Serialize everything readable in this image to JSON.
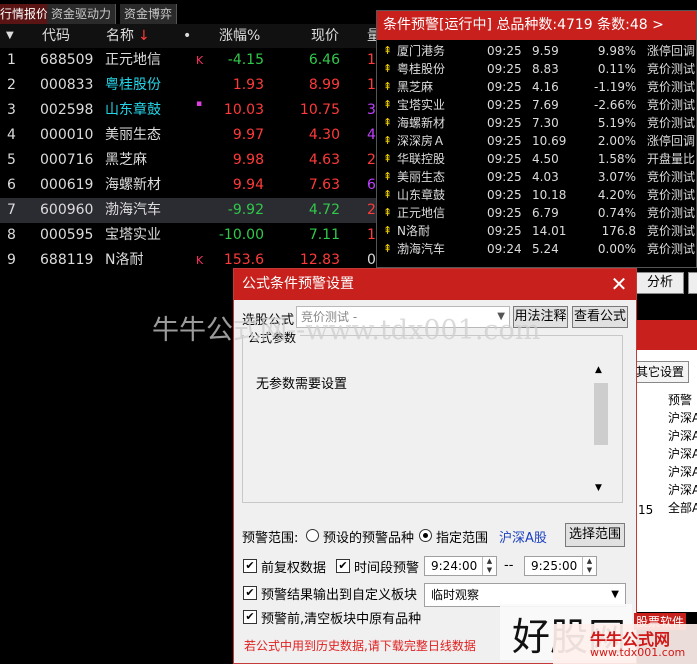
{
  "tabs": [
    "行情报价",
    "资金驱动力",
    "资金博弈"
  ],
  "table": {
    "headers": {
      "menu": "▼",
      "code": "代码",
      "name": "名称",
      "sort": "↓",
      "dot": "•",
      "chg": "涨幅%",
      "price": "现价",
      "extra": "量"
    },
    "rows": [
      {
        "idx": "1",
        "code": "688509",
        "name": "正元地信",
        "mark": "K",
        "chg": "-4.15",
        "price": "6.46",
        "extra": "1",
        "dir": "down",
        "cyan": false
      },
      {
        "idx": "2",
        "code": "000833",
        "name": "粤桂股份",
        "mark": "",
        "chg": "1.93",
        "price": "8.99",
        "extra": "1",
        "dir": "up",
        "cyan": true
      },
      {
        "idx": "3",
        "code": "002598",
        "name": "山东章鼓",
        "mark": "▪",
        "chg": "10.03",
        "price": "10.75",
        "extra": "3",
        "dir": "up",
        "cyan": true
      },
      {
        "idx": "4",
        "code": "000010",
        "name": "美丽生态",
        "mark": "",
        "chg": "9.97",
        "price": "4.30",
        "extra": "4",
        "dir": "up",
        "cyan": false
      },
      {
        "idx": "5",
        "code": "000716",
        "name": "黑芝麻",
        "mark": "",
        "chg": "9.98",
        "price": "4.63",
        "extra": "2",
        "dir": "up",
        "cyan": false
      },
      {
        "idx": "6",
        "code": "000619",
        "name": "海螺新材",
        "mark": "",
        "chg": "9.94",
        "price": "7.63",
        "extra": "6",
        "dir": "up",
        "cyan": false
      },
      {
        "idx": "7",
        "code": "600960",
        "name": "渤海汽车",
        "mark": "",
        "chg": "-9.92",
        "price": "4.72",
        "extra": "2",
        "dir": "down",
        "cyan": false
      },
      {
        "idx": "8",
        "code": "000595",
        "name": "宝塔实业",
        "mark": "",
        "chg": "-10.00",
        "price": "7.11",
        "extra": "1",
        "dir": "down",
        "cyan": false
      },
      {
        "idx": "9",
        "code": "688119",
        "name": "N洛耐",
        "mark": "K",
        "chg": "153.6",
        "price": "12.83",
        "extra": "0",
        "dir": "up",
        "cyan": false
      }
    ]
  },
  "alert": {
    "title": "条件预警[运行中] 总品种数:4719 条数:48  >",
    "rows": [
      {
        "name": "厦门港务",
        "time": "09:25",
        "price": "9.59",
        "pct": "9.98%",
        "status": "涨停回调"
      },
      {
        "name": "粤桂股份",
        "time": "09:25",
        "price": "8.83",
        "pct": "0.11%",
        "status": "竞价测试"
      },
      {
        "name": "黑芝麻",
        "time": "09:25",
        "price": "4.16",
        "pct": "-1.19%",
        "status": "竞价测试"
      },
      {
        "name": "宝塔实业",
        "time": "09:25",
        "price": "7.69",
        "pct": "-2.66%",
        "status": "竞价测试"
      },
      {
        "name": "海螺新材",
        "time": "09:25",
        "price": "7.30",
        "pct": "5.19%",
        "status": "竞价测试"
      },
      {
        "name": "深深房Ａ",
        "time": "09:25",
        "price": "10.69",
        "pct": "2.00%",
        "status": "涨停回调"
      },
      {
        "name": "华联控股",
        "time": "09:25",
        "price": "4.50",
        "pct": "1.58%",
        "status": "开盘量比"
      },
      {
        "name": "美丽生态",
        "time": "09:25",
        "price": "4.03",
        "pct": "3.07%",
        "status": "竞价测试"
      },
      {
        "name": "山东章鼓",
        "time": "09:25",
        "price": "10.18",
        "pct": "4.20%",
        "status": "竞价测试"
      },
      {
        "name": "正元地信",
        "time": "09:25",
        "price": "6.79",
        "pct": "0.74%",
        "status": "竞价测试"
      },
      {
        "name": "N洛耐",
        "time": "09:25",
        "price": "14.01",
        "pct": "176.8",
        "status": "竞价测试"
      },
      {
        "name": "渤海汽车",
        "time": "09:24",
        "price": "5.24",
        "pct": "0.00%",
        "status": "竞价测试"
      }
    ]
  },
  "side": {
    "analyze": "分析",
    "tab": "其它设置",
    "col": "预警",
    "rows": [
      "沪深A",
      "沪深A",
      "沪深A",
      "沪深A",
      "沪深A",
      "全部A"
    ],
    "left_num": "15"
  },
  "dialog": {
    "title": "公式条件预警设置",
    "close": "✕",
    "formula_label": "选股公式",
    "formula_value": "竞价测试  -",
    "usage_btn": "用法注释",
    "view_btn": "查看公式",
    "params_legend": "公式参数",
    "params_text": "无参数需要设置",
    "scope_label": "预警范围:",
    "scope_opt1": "预设的预警品种",
    "scope_opt2": "指定范围",
    "scope_value": "沪深A股",
    "scope_btn": "选择范围",
    "chk_fq": "前复权数据",
    "chk_time": "时间段预警",
    "time_from": "9:24:00",
    "time_sep": "--",
    "time_to": "9:25:00",
    "chk_output": "预警结果输出到自定义板块",
    "block_value": "临时观察",
    "chk_clear": "预警前,清空板块中原有品种",
    "warning": "若公式中用到历史数据,请下载完整日线数据"
  },
  "watermarks": {
    "mid": "牛牛公式网--www.tdx001.com",
    "big": "好股网",
    "small": "股票软件",
    "logo": "牛牛公式网",
    "url": "www.tdx001.com"
  }
}
